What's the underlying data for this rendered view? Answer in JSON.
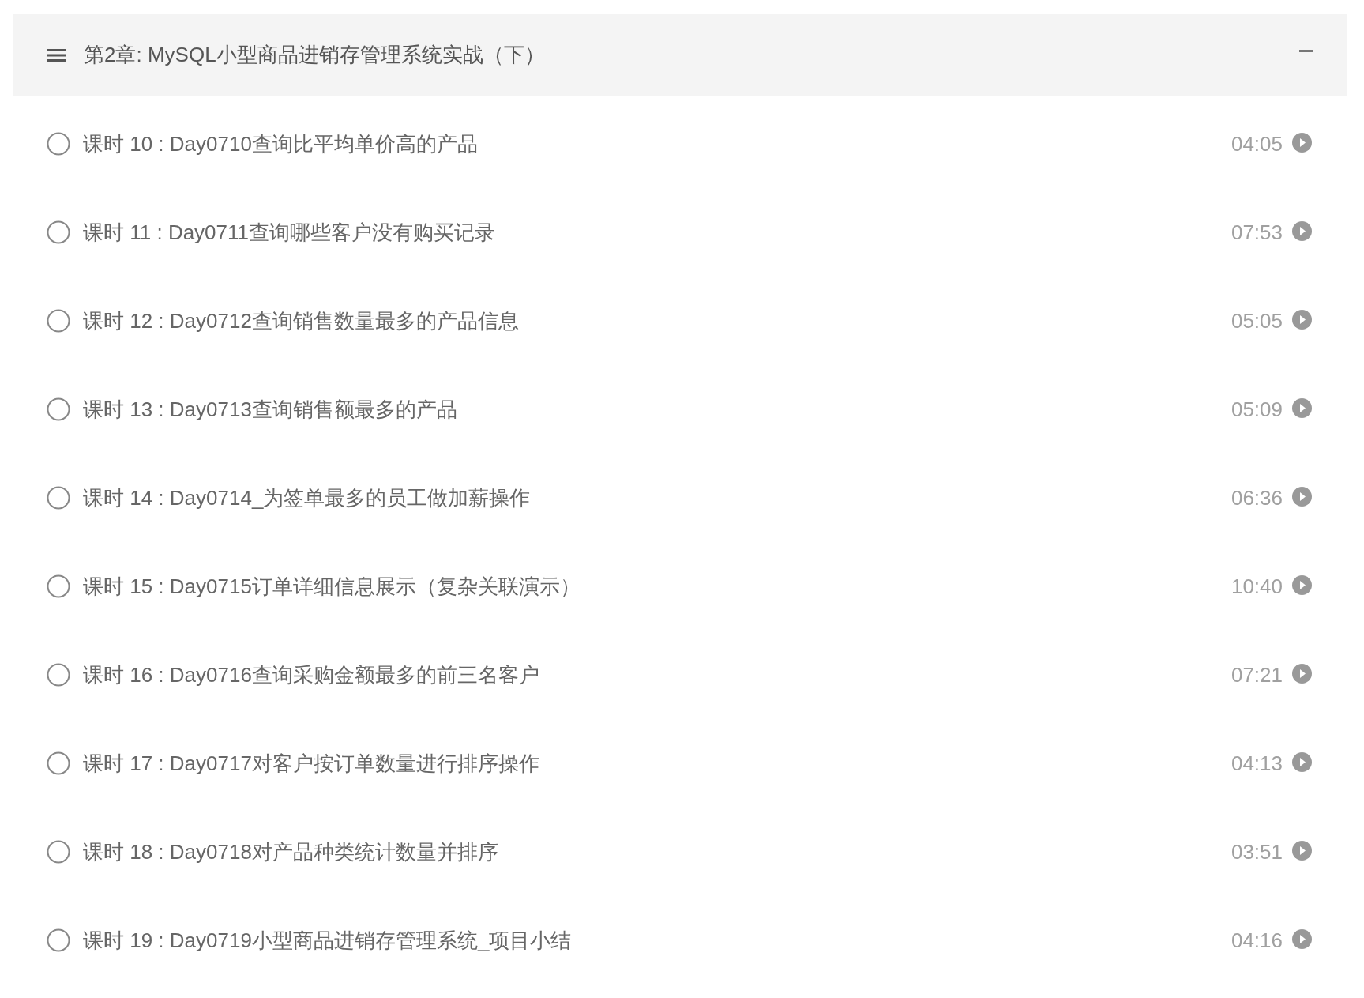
{
  "chapter": {
    "title": "第2章: MySQL小型商品进销存管理系统实战（下）",
    "expanded": true
  },
  "lessons": [
    {
      "label": "课时 10 : Day0710查询比平均单价高的产品",
      "duration": "04:05",
      "completed": false
    },
    {
      "label": "课时 11 : Day0711查询哪些客户没有购买记录",
      "duration": "07:53",
      "completed": false
    },
    {
      "label": "课时 12 : Day0712查询销售数量最多的产品信息",
      "duration": "05:05",
      "completed": false
    },
    {
      "label": "课时 13 : Day0713查询销售额最多的产品",
      "duration": "05:09",
      "completed": false
    },
    {
      "label": "课时 14 : Day0714_为签单最多的员工做加薪操作",
      "duration": "06:36",
      "completed": false
    },
    {
      "label": "课时 15 : Day0715订单详细信息展示（复杂关联演示）",
      "duration": "10:40",
      "completed": false
    },
    {
      "label": "课时 16 : Day0716查询采购金额最多的前三名客户",
      "duration": "07:21",
      "completed": false
    },
    {
      "label": "课时 17 : Day0717对客户按订单数量进行排序操作",
      "duration": "04:13",
      "completed": false
    },
    {
      "label": "课时 18 : Day0718对产品种类统计数量并排序",
      "duration": "03:51",
      "completed": false
    },
    {
      "label": "课时 19 : Day0719小型商品进销存管理系统_项目小结",
      "duration": "04:16",
      "completed": false
    }
  ]
}
